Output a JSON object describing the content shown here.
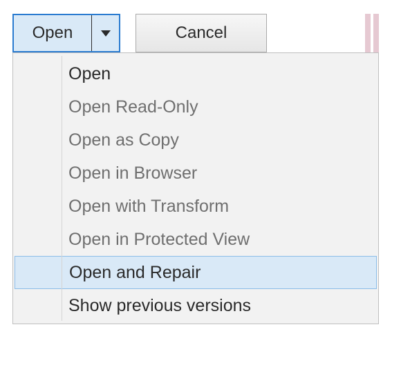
{
  "buttons": {
    "open_label": "Open",
    "cancel_label": "Cancel"
  },
  "menu": {
    "items": [
      {
        "label": "Open",
        "enabled": true,
        "highlight": false
      },
      {
        "label": "Open Read-Only",
        "enabled": false,
        "highlight": false
      },
      {
        "label": "Open as Copy",
        "enabled": false,
        "highlight": false
      },
      {
        "label": "Open in Browser",
        "enabled": false,
        "highlight": false
      },
      {
        "label": "Open with Transform",
        "enabled": false,
        "highlight": false
      },
      {
        "label": "Open in Protected View",
        "enabled": false,
        "highlight": false
      },
      {
        "label": "Open and Repair",
        "enabled": true,
        "highlight": true
      },
      {
        "label": "Show previous versions",
        "enabled": true,
        "highlight": false
      }
    ]
  }
}
